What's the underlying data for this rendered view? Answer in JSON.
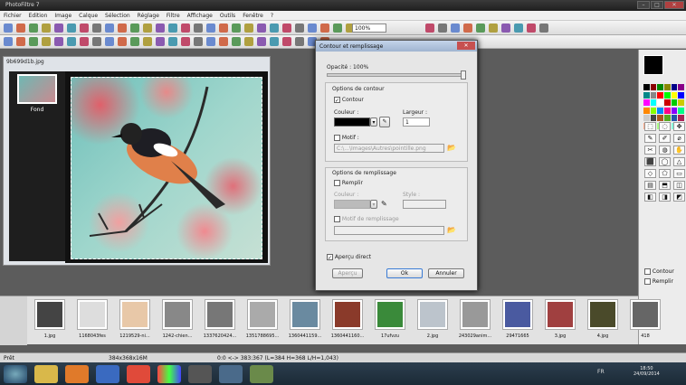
{
  "app": {
    "title": "PhotoFiltre 7"
  },
  "menu": [
    "Fichier",
    "Edition",
    "Image",
    "Calque",
    "Sélection",
    "Réglage",
    "Filtre",
    "Affichage",
    "Outils",
    "Fenêtre",
    "?"
  ],
  "toolbar": {
    "zoom": "100%"
  },
  "document": {
    "title": "9b699d1b.jpg",
    "layer_name": "Fond"
  },
  "dialog": {
    "title": "Contour et remplissage",
    "opacity_label": "Opacité : 100%",
    "contour_group": "Options de contour",
    "contour_check": "Contour",
    "couleur": "Couleur :",
    "largeur": "Largeur :",
    "largeur_value": "1",
    "motif": "Motif :",
    "motif_path": "C:\\...\\Images\\Autres\\pointille.png",
    "fill_group": "Options de remplissage",
    "remplir": "Remplir",
    "couleur2": "Couleur :",
    "style": "Style :",
    "motif_remplissage": "Motif de remplissage",
    "apercu_direct": "Aperçu direct",
    "apercu_btn": "Aperçu",
    "ok_btn": "Ok",
    "annuler_btn": "Annuler"
  },
  "right_panel": {
    "contour": "Contour",
    "remplir": "Remplir"
  },
  "filmstrip": [
    {
      "label": "1.jpg",
      "color": "#444"
    },
    {
      "label": "1168043fes",
      "color": "#ddd"
    },
    {
      "label": "1219529-ni...",
      "color": "#e8c8a8"
    },
    {
      "label": "1242-chien...",
      "color": "#888"
    },
    {
      "label": "1337620424...",
      "color": "#777"
    },
    {
      "label": "1351788695...",
      "color": "#aaa"
    },
    {
      "label": "1360441159...",
      "color": "#6a8aa0"
    },
    {
      "label": "1360441160...",
      "color": "#8a3a2a"
    },
    {
      "label": "17ufvzu",
      "color": "#3a8a3a"
    },
    {
      "label": "2.jpg",
      "color": "#bcc4cc"
    },
    {
      "label": "243029anim...",
      "color": "#999"
    },
    {
      "label": "29471665",
      "color": "#4a5aa0"
    },
    {
      "label": "3.jpg",
      "color": "#a04040"
    },
    {
      "label": "4.jpg",
      "color": "#4a4a2a"
    },
    {
      "label": "418",
      "color": "#666"
    }
  ],
  "status": {
    "left": "Prêt",
    "size": "384x368x16M",
    "coords": "0:0 <-> 383:367 (L=384 H=368 L/H=1,043)"
  },
  "clock": {
    "time": "18:50",
    "date": "24/09/2014",
    "lang": "FR"
  }
}
